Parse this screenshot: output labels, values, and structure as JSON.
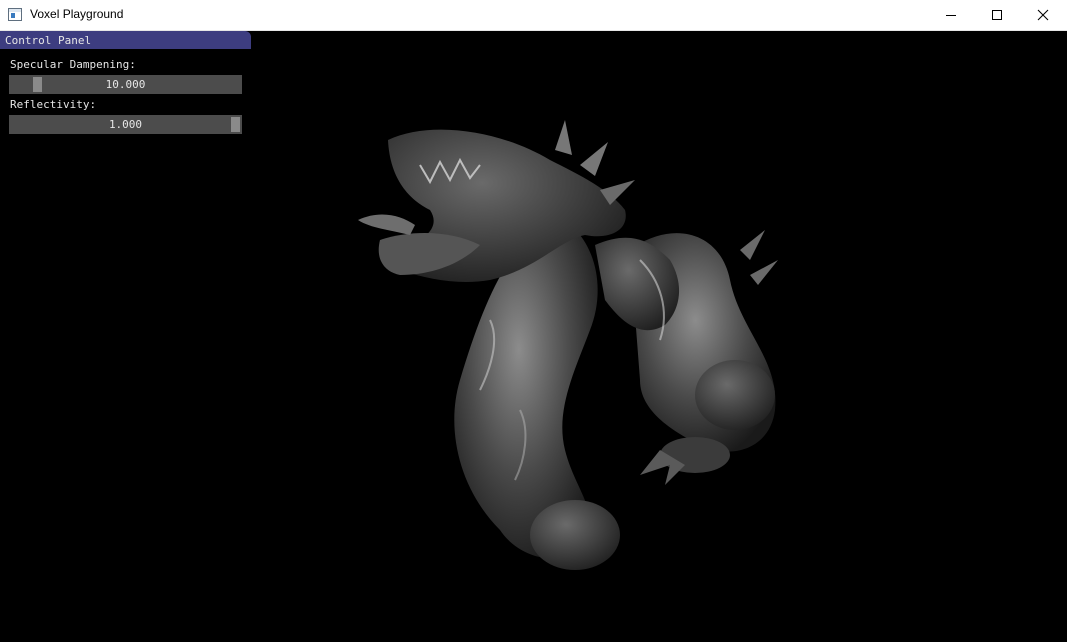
{
  "window": {
    "title": "Voxel Playground",
    "icon": "app-window-icon",
    "controls": [
      "minimize-icon",
      "maximize-icon",
      "close-icon"
    ]
  },
  "panel": {
    "title": "Control Panel",
    "header_color": "#3d3d80",
    "sliders": [
      {
        "label": "Specular Dampening:",
        "value": "10.000",
        "level": 0.1
      },
      {
        "label": "Reflectivity:",
        "value": "1.000",
        "level": 1.0
      }
    ]
  },
  "scene": {
    "subject": "dragon-model",
    "background_color": "#000000"
  }
}
